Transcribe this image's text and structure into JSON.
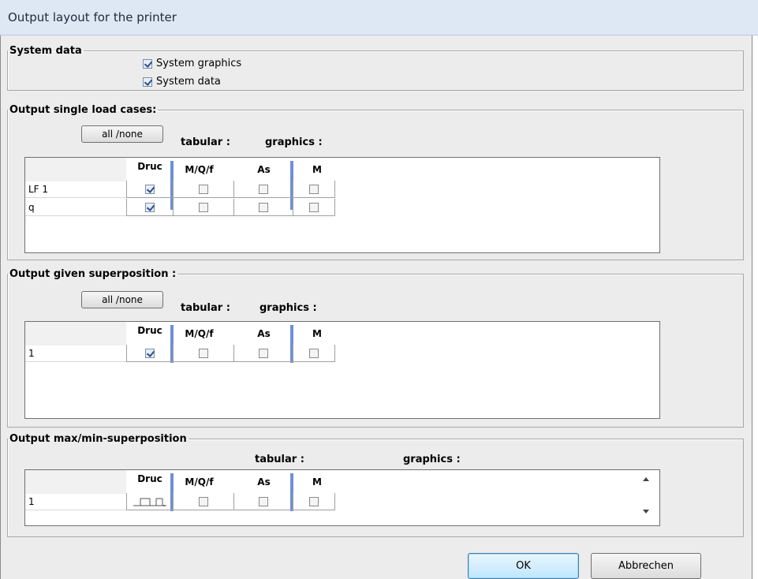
{
  "window": {
    "title": "Output layout for the printer"
  },
  "system_data": {
    "legend": "System data",
    "options": [
      {
        "label": "System graphics",
        "checked": true
      },
      {
        "label": "System data",
        "checked": true
      }
    ]
  },
  "single_load_cases": {
    "legend": "Output single load cases:",
    "all_none": "all /none",
    "tabular": "tabular :",
    "graphics": "graphics :",
    "columns": [
      "Druc",
      "M/Q/f",
      "As",
      "M"
    ],
    "rows": [
      {
        "name": "LF 1",
        "values": [
          true,
          false,
          false,
          false
        ]
      },
      {
        "name": "q",
        "values": [
          true,
          false,
          false,
          false
        ]
      }
    ]
  },
  "given_superposition": {
    "legend": "Output given superposition :",
    "all_none": "all /none",
    "tabular": "tabular :",
    "graphics": "graphics :",
    "columns": [
      "Druc",
      "M/Q/f",
      "As",
      "M"
    ],
    "rows": [
      {
        "name": "1",
        "values": [
          true,
          false,
          false,
          false
        ]
      }
    ]
  },
  "maxmin_superposition": {
    "legend": "Output max/min-superposition",
    "tabular": "tabular :",
    "graphics": "graphics :",
    "columns": [
      "Druc",
      "M/Q/f",
      "As",
      "M"
    ],
    "rows": [
      {
        "name": "1",
        "values": [
          null,
          false,
          false,
          false
        ]
      }
    ]
  },
  "buttons": {
    "ok": "OK",
    "cancel": "Abbrechen"
  }
}
